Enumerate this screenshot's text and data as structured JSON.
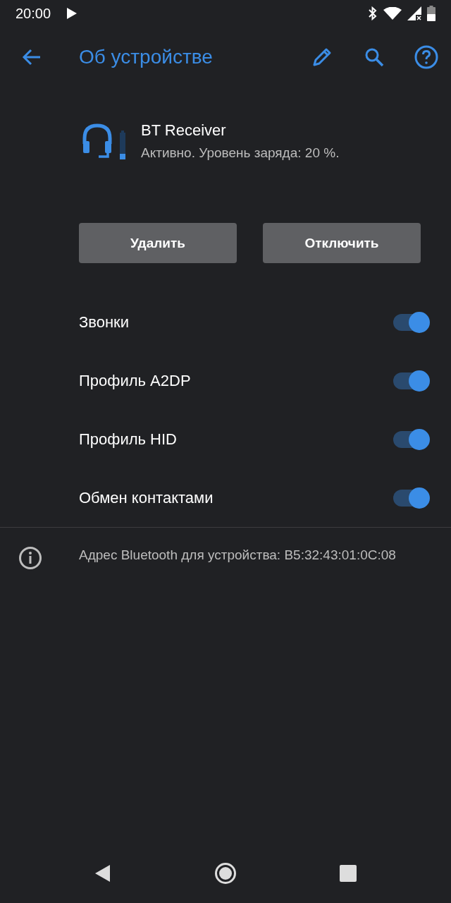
{
  "status_bar": {
    "time": "20:00"
  },
  "app_bar": {
    "title": "Об устройстве"
  },
  "device": {
    "name": "BT Receiver",
    "status": "Активно. Уровень заряда: 20 %."
  },
  "buttons": [
    "Удалить",
    "Отключить"
  ],
  "toggles": [
    {
      "label": "Звонки",
      "on": true
    },
    {
      "label": "Профиль A2DP",
      "on": true
    },
    {
      "label": "Профиль HID",
      "on": true
    },
    {
      "label": "Обмен контактами",
      "on": true
    }
  ],
  "info": {
    "text": "Адрес Bluetooth для устройства: B5:32:43:01:0C:08"
  }
}
